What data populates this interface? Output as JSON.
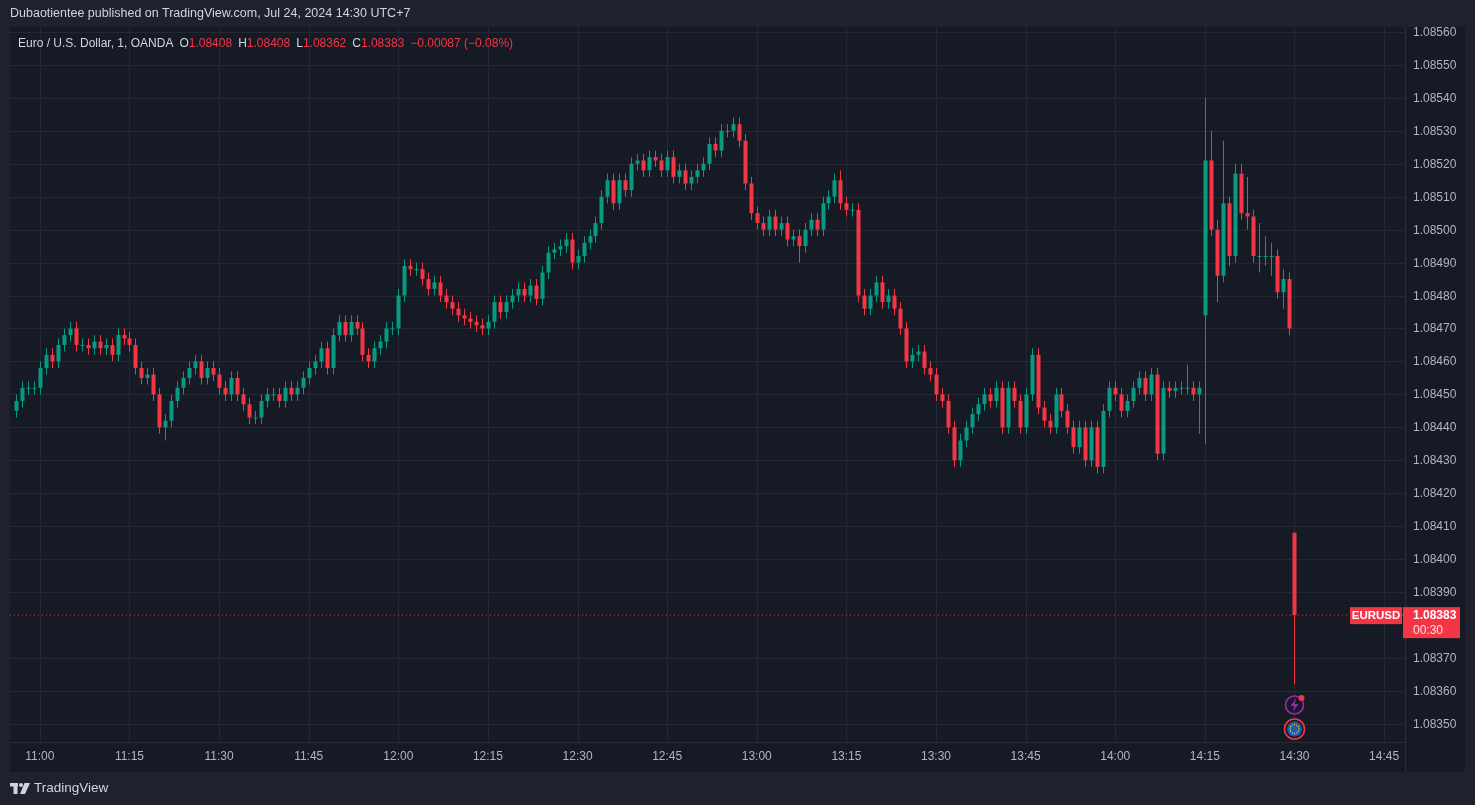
{
  "header": {
    "text": "Dubaotientee published on TradingView.com, Jul 24, 2024 14:30 UTC+7"
  },
  "chart": {
    "legend": {
      "symbol": "Euro / U.S. Dollar, 1, OANDA",
      "ohlc": [
        {
          "label": "O",
          "value": "1.08408"
        },
        {
          "label": "H",
          "value": "1.08408"
        },
        {
          "label": "L",
          "value": "1.08362"
        },
        {
          "label": "C",
          "value": "1.08383"
        }
      ],
      "change": "−0.00087 (−0.08%)"
    },
    "price_tag": {
      "symbol": "EURUSD",
      "price": "1.08383",
      "countdown": "00:30"
    },
    "chart_data": {
      "type": "candlestick",
      "grid": true,
      "ref_lines": [
        {
          "axis": "y",
          "value": 1.08383,
          "color": "#f23645"
        }
      ],
      "xlim": [
        655,
        888.5
      ],
      "ylim": [
        1.083445,
        1.085615
      ],
      "xticks": [
        {
          "value": 660,
          "label": "11:00"
        },
        {
          "value": 675,
          "label": "11:15"
        },
        {
          "value": 690,
          "label": "11:30"
        },
        {
          "value": 705,
          "label": "11:45"
        },
        {
          "value": 720,
          "label": "12:00"
        },
        {
          "value": 735,
          "label": "12:15"
        },
        {
          "value": 750,
          "label": "12:30"
        },
        {
          "value": 765,
          "label": "12:45"
        },
        {
          "value": 780,
          "label": "13:00"
        },
        {
          "value": 795,
          "label": "13:15"
        },
        {
          "value": 810,
          "label": "13:30"
        },
        {
          "value": 825,
          "label": "13:45"
        },
        {
          "value": 840,
          "label": "14:00"
        },
        {
          "value": 855,
          "label": "14:15"
        },
        {
          "value": 870,
          "label": "14:30"
        },
        {
          "value": 885,
          "label": "14:45"
        }
      ],
      "yticks": [
        {
          "value": 1.0856,
          "label": "1.08560"
        },
        {
          "value": 1.0855,
          "label": "1.08550"
        },
        {
          "value": 1.0854,
          "label": "1.08540"
        },
        {
          "value": 1.0853,
          "label": "1.08530"
        },
        {
          "value": 1.0852,
          "label": "1.08520"
        },
        {
          "value": 1.0851,
          "label": "1.08510"
        },
        {
          "value": 1.085,
          "label": "1.08500"
        },
        {
          "value": 1.0849,
          "label": "1.08490"
        },
        {
          "value": 1.0848,
          "label": "1.08480"
        },
        {
          "value": 1.0847,
          "label": "1.08470"
        },
        {
          "value": 1.0846,
          "label": "1.08460"
        },
        {
          "value": 1.0845,
          "label": "1.08450"
        },
        {
          "value": 1.0844,
          "label": "1.08440"
        },
        {
          "value": 1.0843,
          "label": "1.08430"
        },
        {
          "value": 1.0842,
          "label": "1.08420"
        },
        {
          "value": 1.0841,
          "label": "1.08410"
        },
        {
          "value": 1.084,
          "label": "1.08400"
        },
        {
          "value": 1.0839,
          "label": "1.08390"
        },
        {
          "value": 1.0837,
          "label": "1.08370"
        },
        {
          "value": 1.0836,
          "label": "1.08360"
        },
        {
          "value": 1.0835,
          "label": "1.08350"
        }
      ],
      "x": [
        656,
        657,
        658,
        659,
        660,
        661,
        662,
        663,
        664,
        665,
        666,
        667,
        668,
        669,
        670,
        671,
        672,
        673,
        674,
        675,
        676,
        677,
        678,
        679,
        680,
        681,
        682,
        683,
        684,
        685,
        686,
        687,
        688,
        689,
        690,
        691,
        692,
        693,
        694,
        695,
        696,
        697,
        698,
        699,
        700,
        701,
        702,
        703,
        704,
        705,
        706,
        707,
        708,
        709,
        710,
        711,
        712,
        713,
        714,
        715,
        716,
        717,
        718,
        719,
        720,
        721,
        722,
        723,
        724,
        725,
        726,
        727,
        728,
        729,
        730,
        731,
        732,
        733,
        734,
        735,
        736,
        737,
        738,
        739,
        740,
        741,
        742,
        743,
        744,
        745,
        746,
        747,
        748,
        749,
        750,
        751,
        752,
        753,
        754,
        755,
        756,
        757,
        758,
        759,
        760,
        761,
        762,
        763,
        764,
        765,
        766,
        767,
        768,
        769,
        770,
        771,
        772,
        773,
        774,
        775,
        776,
        777,
        778,
        779,
        780,
        781,
        782,
        783,
        784,
        785,
        786,
        787,
        788,
        789,
        790,
        791,
        792,
        793,
        794,
        795,
        796,
        797,
        798,
        799,
        800,
        801,
        802,
        803,
        804,
        805,
        806,
        807,
        808,
        809,
        810,
        811,
        812,
        813,
        814,
        815,
        816,
        817,
        818,
        819,
        820,
        821,
        822,
        823,
        824,
        825,
        826,
        827,
        828,
        829,
        830,
        831,
        832,
        833,
        834,
        835,
        836,
        837,
        838,
        839,
        840,
        841,
        842,
        843,
        844,
        845,
        846,
        847,
        848,
        849,
        850,
        851,
        852,
        853,
        854,
        855,
        856,
        857,
        858,
        859,
        860,
        861,
        862,
        863,
        864,
        865,
        866,
        867,
        868,
        869,
        870
      ],
      "ohlc": [
        [
          1.08445,
          1.0845,
          1.08443,
          1.08448
        ],
        [
          1.08448,
          1.08454,
          1.08446,
          1.08452
        ],
        [
          1.08452,
          1.08454,
          1.0845,
          1.08452
        ],
        [
          1.08452,
          1.08454,
          1.0845,
          1.08452
        ],
        [
          1.08452,
          1.0846,
          1.0845,
          1.08458
        ],
        [
          1.08458,
          1.08464,
          1.08456,
          1.08462
        ],
        [
          1.08462,
          1.08464,
          1.08458,
          1.0846
        ],
        [
          1.0846,
          1.08467,
          1.08458,
          1.08465
        ],
        [
          1.08465,
          1.0847,
          1.08463,
          1.08468
        ],
        [
          1.08468,
          1.08472,
          1.08466,
          1.0847
        ],
        [
          1.0847,
          1.08472,
          1.08463,
          1.08465
        ],
        [
          1.08465,
          1.08467,
          1.08463,
          1.08465
        ],
        [
          1.08465,
          1.08467,
          1.08462,
          1.08464
        ],
        [
          1.08464,
          1.08468,
          1.08462,
          1.08466
        ],
        [
          1.08466,
          1.08468,
          1.08462,
          1.08464
        ],
        [
          1.08464,
          1.08467,
          1.08462,
          1.08465
        ],
        [
          1.08465,
          1.08467,
          1.0846,
          1.08462
        ],
        [
          1.08462,
          1.0847,
          1.0846,
          1.08468
        ],
        [
          1.08468,
          1.0847,
          1.08465,
          1.08467
        ],
        [
          1.08467,
          1.08469,
          1.08463,
          1.08465
        ],
        [
          1.08465,
          1.08467,
          1.08456,
          1.08458
        ],
        [
          1.08458,
          1.0846,
          1.08453,
          1.08455
        ],
        [
          1.08455,
          1.08458,
          1.08453,
          1.08456
        ],
        [
          1.08456,
          1.08458,
          1.08448,
          1.0845
        ],
        [
          1.0845,
          1.08452,
          1.08438,
          1.0844
        ],
        [
          1.0844,
          1.08444,
          1.08436,
          1.08442
        ],
        [
          1.08442,
          1.0845,
          1.0844,
          1.08448
        ],
        [
          1.08448,
          1.08454,
          1.08446,
          1.08452
        ],
        [
          1.08452,
          1.08457,
          1.0845,
          1.08455
        ],
        [
          1.08455,
          1.0846,
          1.08453,
          1.08458
        ],
        [
          1.08458,
          1.08462,
          1.08456,
          1.0846
        ],
        [
          1.0846,
          1.08462,
          1.08453,
          1.08455
        ],
        [
          1.08455,
          1.0846,
          1.08453,
          1.08458
        ],
        [
          1.08458,
          1.0846,
          1.08454,
          1.08456
        ],
        [
          1.08456,
          1.08458,
          1.0845,
          1.08452
        ],
        [
          1.08452,
          1.08454,
          1.08448,
          1.0845
        ],
        [
          1.0845,
          1.08457,
          1.08448,
          1.08455
        ],
        [
          1.08455,
          1.08457,
          1.08448,
          1.0845
        ],
        [
          1.0845,
          1.08452,
          1.08445,
          1.08447
        ],
        [
          1.08447,
          1.08449,
          1.08441,
          1.08443
        ],
        [
          1.08443,
          1.08445,
          1.08441,
          1.08443
        ],
        [
          1.08443,
          1.0845,
          1.08441,
          1.08448
        ],
        [
          1.08448,
          1.08452,
          1.08446,
          1.0845
        ],
        [
          1.0845,
          1.08452,
          1.08448,
          1.0845
        ],
        [
          1.0845,
          1.08452,
          1.08446,
          1.08448
        ],
        [
          1.08448,
          1.08454,
          1.08446,
          1.08452
        ],
        [
          1.08452,
          1.08454,
          1.08448,
          1.0845
        ],
        [
          1.0845,
          1.08454,
          1.08448,
          1.08452
        ],
        [
          1.08452,
          1.08457,
          1.0845,
          1.08455
        ],
        [
          1.08455,
          1.0846,
          1.08453,
          1.08458
        ],
        [
          1.08458,
          1.08462,
          1.08456,
          1.0846
        ],
        [
          1.0846,
          1.08466,
          1.08458,
          1.08464
        ],
        [
          1.08464,
          1.08466,
          1.08456,
          1.08458
        ],
        [
          1.08458,
          1.0847,
          1.08456,
          1.08468
        ],
        [
          1.08468,
          1.08474,
          1.08466,
          1.08472
        ],
        [
          1.08472,
          1.08474,
          1.08466,
          1.08468
        ],
        [
          1.08468,
          1.08474,
          1.08466,
          1.08472
        ],
        [
          1.08472,
          1.08474,
          1.08468,
          1.0847
        ],
        [
          1.0847,
          1.08472,
          1.0846,
          1.08462
        ],
        [
          1.08462,
          1.08464,
          1.08458,
          1.0846
        ],
        [
          1.0846,
          1.08466,
          1.08458,
          1.08464
        ],
        [
          1.08464,
          1.08468,
          1.08462,
          1.08466
        ],
        [
          1.08466,
          1.08472,
          1.08464,
          1.0847
        ],
        [
          1.0847,
          1.08472,
          1.08468,
          1.0847
        ],
        [
          1.0847,
          1.08482,
          1.08468,
          1.0848
        ],
        [
          1.0848,
          1.08491,
          1.08478,
          1.08489
        ],
        [
          1.08489,
          1.08491,
          1.08486,
          1.08488
        ],
        [
          1.08488,
          1.0849,
          1.08486,
          1.08488
        ],
        [
          1.08488,
          1.0849,
          1.08483,
          1.08485
        ],
        [
          1.08485,
          1.08487,
          1.0848,
          1.08482
        ],
        [
          1.08482,
          1.08486,
          1.0848,
          1.08484
        ],
        [
          1.08484,
          1.08486,
          1.08478,
          1.0848
        ],
        [
          1.0848,
          1.08482,
          1.08476,
          1.08478
        ],
        [
          1.08478,
          1.0848,
          1.08474,
          1.08476
        ],
        [
          1.08476,
          1.08478,
          1.08472,
          1.08474
        ],
        [
          1.08474,
          1.08476,
          1.08471,
          1.08473
        ],
        [
          1.08473,
          1.08475,
          1.0847,
          1.08472
        ],
        [
          1.08472,
          1.08474,
          1.08469,
          1.08471
        ],
        [
          1.08471,
          1.08473,
          1.08468,
          1.0847
        ],
        [
          1.0847,
          1.08474,
          1.08468,
          1.08472
        ],
        [
          1.08472,
          1.0848,
          1.0847,
          1.08478
        ],
        [
          1.08478,
          1.0848,
          1.08473,
          1.08475
        ],
        [
          1.08475,
          1.0848,
          1.08473,
          1.08478
        ],
        [
          1.08478,
          1.08482,
          1.08476,
          1.0848
        ],
        [
          1.0848,
          1.08484,
          1.08478,
          1.08482
        ],
        [
          1.08482,
          1.08484,
          1.08478,
          1.0848
        ],
        [
          1.0848,
          1.08485,
          1.08478,
          1.08483
        ],
        [
          1.08483,
          1.08485,
          1.08477,
          1.08479
        ],
        [
          1.08479,
          1.08489,
          1.08477,
          1.08487
        ],
        [
          1.08487,
          1.08495,
          1.08485,
          1.08493
        ],
        [
          1.08493,
          1.08496,
          1.08491,
          1.08494
        ],
        [
          1.08494,
          1.08497,
          1.08492,
          1.08495
        ],
        [
          1.08495,
          1.08499,
          1.08493,
          1.08497
        ],
        [
          1.08497,
          1.08499,
          1.08488,
          1.0849
        ],
        [
          1.0849,
          1.08494,
          1.08488,
          1.08492
        ],
        [
          1.08492,
          1.08498,
          1.0849,
          1.08496
        ],
        [
          1.08496,
          1.085,
          1.08494,
          1.08498
        ],
        [
          1.08498,
          1.08504,
          1.08496,
          1.08502
        ],
        [
          1.08502,
          1.08512,
          1.085,
          1.0851
        ],
        [
          1.0851,
          1.08517,
          1.08508,
          1.08515
        ],
        [
          1.08515,
          1.08517,
          1.08506,
          1.08508
        ],
        [
          1.08508,
          1.08517,
          1.08506,
          1.08515
        ],
        [
          1.08515,
          1.08517,
          1.0851,
          1.08512
        ],
        [
          1.08512,
          1.08522,
          1.0851,
          1.0852
        ],
        [
          1.0852,
          1.08523,
          1.08518,
          1.08521
        ],
        [
          1.08521,
          1.08523,
          1.08516,
          1.08518
        ],
        [
          1.08518,
          1.08524,
          1.08516,
          1.08522
        ],
        [
          1.08522,
          1.08524,
          1.08519,
          1.08521
        ],
        [
          1.08521,
          1.08523,
          1.08516,
          1.08518
        ],
        [
          1.08518,
          1.08524,
          1.08516,
          1.08522
        ],
        [
          1.08522,
          1.08524,
          1.08514,
          1.08516
        ],
        [
          1.08516,
          1.0852,
          1.08514,
          1.08518
        ],
        [
          1.08518,
          1.0852,
          1.08512,
          1.08514
        ],
        [
          1.08514,
          1.08518,
          1.08512,
          1.08516
        ],
        [
          1.08516,
          1.0852,
          1.08514,
          1.08518
        ],
        [
          1.08518,
          1.08522,
          1.08516,
          1.0852
        ],
        [
          1.0852,
          1.08528,
          1.08518,
          1.08526
        ],
        [
          1.08526,
          1.08528,
          1.08522,
          1.08524
        ],
        [
          1.08524,
          1.08532,
          1.08522,
          1.0853
        ],
        [
          1.0853,
          1.08532,
          1.08528,
          1.0853
        ],
        [
          1.0853,
          1.08534,
          1.08528,
          1.08532
        ],
        [
          1.08532,
          1.08534,
          1.08525,
          1.08527
        ],
        [
          1.08527,
          1.08529,
          1.08512,
          1.08514
        ],
        [
          1.08514,
          1.08516,
          1.08503,
          1.08505
        ],
        [
          1.08505,
          1.08507,
          1.085,
          1.08502
        ],
        [
          1.08502,
          1.08504,
          1.08498,
          1.085
        ],
        [
          1.085,
          1.08506,
          1.08498,
          1.08504
        ],
        [
          1.08504,
          1.08506,
          1.08498,
          1.085
        ],
        [
          1.085,
          1.08504,
          1.08498,
          1.08502
        ],
        [
          1.08502,
          1.08504,
          1.08495,
          1.08497
        ],
        [
          1.08497,
          1.085,
          1.08495,
          1.08498
        ],
        [
          1.08498,
          1.085,
          1.0849,
          1.08495
        ],
        [
          1.08495,
          1.08502,
          1.08493,
          1.085
        ],
        [
          1.085,
          1.08505,
          1.08498,
          1.08503
        ],
        [
          1.08503,
          1.08505,
          1.08498,
          1.085
        ],
        [
          1.085,
          1.0851,
          1.08498,
          1.08508
        ],
        [
          1.08508,
          1.08512,
          1.08506,
          1.0851
        ],
        [
          1.0851,
          1.08517,
          1.08508,
          1.08515
        ],
        [
          1.08515,
          1.08518,
          1.08506,
          1.08508
        ],
        [
          1.08508,
          1.0851,
          1.08504,
          1.08506
        ],
        [
          1.08506,
          1.08508,
          1.08504,
          1.08506
        ],
        [
          1.08506,
          1.08508,
          1.08478,
          1.0848
        ],
        [
          1.0848,
          1.08482,
          1.08474,
          1.08476
        ],
        [
          1.08476,
          1.08482,
          1.08474,
          1.0848
        ],
        [
          1.0848,
          1.08486,
          1.08478,
          1.08484
        ],
        [
          1.08484,
          1.08486,
          1.08476,
          1.08478
        ],
        [
          1.08478,
          1.08482,
          1.08476,
          1.0848
        ],
        [
          1.0848,
          1.08482,
          1.08474,
          1.08476
        ],
        [
          1.08476,
          1.08478,
          1.08468,
          1.0847
        ],
        [
          1.0847,
          1.08472,
          1.08458,
          1.0846
        ],
        [
          1.0846,
          1.08464,
          1.08458,
          1.08462
        ],
        [
          1.08462,
          1.08465,
          1.0846,
          1.08463
        ],
        [
          1.08463,
          1.08465,
          1.08456,
          1.08458
        ],
        [
          1.08458,
          1.0846,
          1.08454,
          1.08456
        ],
        [
          1.08456,
          1.08458,
          1.08448,
          1.0845
        ],
        [
          1.0845,
          1.08452,
          1.08446,
          1.08448
        ],
        [
          1.08448,
          1.0845,
          1.08438,
          1.0844
        ],
        [
          1.0844,
          1.08442,
          1.08428,
          1.0843
        ],
        [
          1.0843,
          1.08438,
          1.08428,
          1.08436
        ],
        [
          1.08436,
          1.08442,
          1.08434,
          1.0844
        ],
        [
          1.0844,
          1.08446,
          1.08438,
          1.08444
        ],
        [
          1.08444,
          1.08449,
          1.08442,
          1.08447
        ],
        [
          1.08447,
          1.08452,
          1.08445,
          1.0845
        ],
        [
          1.0845,
          1.08452,
          1.08446,
          1.08448
        ],
        [
          1.08448,
          1.08454,
          1.08446,
          1.08452
        ],
        [
          1.08452,
          1.08454,
          1.08438,
          1.0844
        ],
        [
          1.0844,
          1.08454,
          1.08438,
          1.08452
        ],
        [
          1.08452,
          1.08454,
          1.08446,
          1.08448
        ],
        [
          1.08448,
          1.0845,
          1.08438,
          1.0844
        ],
        [
          1.0844,
          1.08452,
          1.08438,
          1.0845
        ],
        [
          1.0845,
          1.08464,
          1.08448,
          1.08462
        ],
        [
          1.08462,
          1.08464,
          1.08444,
          1.08446
        ],
        [
          1.08446,
          1.08448,
          1.0844,
          1.08442
        ],
        [
          1.08442,
          1.08444,
          1.08438,
          1.0844
        ],
        [
          1.0844,
          1.08452,
          1.08438,
          1.0845
        ],
        [
          1.0845,
          1.08452,
          1.08443,
          1.08445
        ],
        [
          1.08445,
          1.08447,
          1.08438,
          1.0844
        ],
        [
          1.0844,
          1.08442,
          1.08432,
          1.08434
        ],
        [
          1.08434,
          1.08442,
          1.08432,
          1.0844
        ],
        [
          1.0844,
          1.08442,
          1.08428,
          1.0843
        ],
        [
          1.0843,
          1.08442,
          1.08428,
          1.0844
        ],
        [
          1.0844,
          1.08442,
          1.08426,
          1.08428
        ],
        [
          1.08428,
          1.08447,
          1.08426,
          1.08445
        ],
        [
          1.08445,
          1.08454,
          1.08443,
          1.08452
        ],
        [
          1.08452,
          1.08454,
          1.08448,
          1.0845
        ],
        [
          1.0845,
          1.08452,
          1.08443,
          1.08445
        ],
        [
          1.08445,
          1.0845,
          1.08443,
          1.08448
        ],
        [
          1.08448,
          1.08454,
          1.08446,
          1.08452
        ],
        [
          1.08452,
          1.08457,
          1.0845,
          1.08455
        ],
        [
          1.08455,
          1.08457,
          1.08448,
          1.0845
        ],
        [
          1.0845,
          1.08458,
          1.08448,
          1.08456
        ],
        [
          1.08456,
          1.08458,
          1.0843,
          1.08432
        ],
        [
          1.08432,
          1.08454,
          1.0843,
          1.08452
        ],
        [
          1.08452,
          1.08454,
          1.08449,
          1.08451
        ],
        [
          1.08451,
          1.08454,
          1.08449,
          1.08452
        ],
        [
          1.08452,
          1.08454,
          1.0845,
          1.08452
        ],
        [
          1.08452,
          1.08459,
          1.0845,
          1.08452
        ],
        [
          1.08452,
          1.08454,
          1.08448,
          1.0845
        ],
        [
          1.0845,
          1.08454,
          1.08438,
          1.08452
        ],
        [
          1.08474,
          1.0854,
          1.08435,
          1.08521
        ],
        [
          1.08521,
          1.0853,
          1.08498,
          1.085
        ],
        [
          1.085,
          1.08503,
          1.08478,
          1.08486
        ],
        [
          1.08486,
          1.08527,
          1.08484,
          1.08508
        ],
        [
          1.08508,
          1.0851,
          1.08489,
          1.08492
        ],
        [
          1.08492,
          1.0852,
          1.0849,
          1.08517
        ],
        [
          1.08517,
          1.0852,
          1.08503,
          1.08505
        ],
        [
          1.08505,
          1.08516,
          1.085,
          1.08504
        ],
        [
          1.08504,
          1.08506,
          1.0849,
          1.08492
        ],
        [
          1.08492,
          1.08502,
          1.08487,
          1.08492
        ],
        [
          1.08492,
          1.08498,
          1.08489,
          1.08492
        ],
        [
          1.08492,
          1.08496,
          1.08486,
          1.08492
        ],
        [
          1.08492,
          1.08494,
          1.08479,
          1.08481
        ],
        [
          1.08481,
          1.08488,
          1.08476,
          1.08485
        ],
        [
          1.08485,
          1.08487,
          1.08468,
          1.0847
        ],
        [
          1.08408,
          1.08408,
          1.08362,
          1.08383
        ]
      ]
    }
  },
  "footer": {
    "brand": "TradingView"
  }
}
